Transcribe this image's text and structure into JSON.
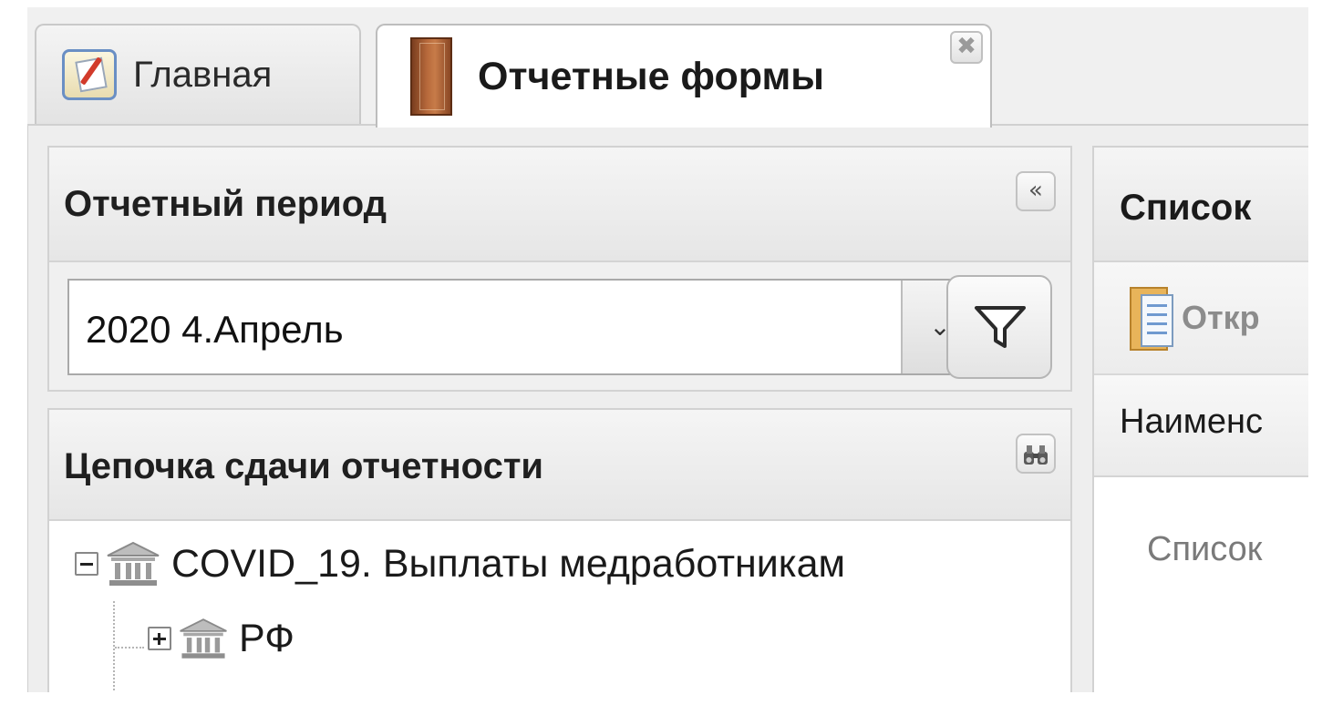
{
  "tabs": [
    {
      "label": "Главная",
      "icon": "home-edit-icon",
      "active": false
    },
    {
      "label": "Отчетные формы",
      "icon": "book-icon",
      "active": true,
      "closable": true
    }
  ],
  "tab_close_glyph": "✖",
  "period_panel": {
    "title": "Отчетный период",
    "collapse_glyph": "«",
    "selected_value": "2020 4.Апрель",
    "dropdown_glyph": "⌄"
  },
  "chain_panel": {
    "title": "Цепочка сдачи отчетности",
    "search_glyph": "🔍",
    "tree": [
      {
        "label": "COVID_19. Выплаты медработникам",
        "expanded": true,
        "level": 0
      },
      {
        "label": "РФ",
        "expanded": false,
        "level": 1
      }
    ]
  },
  "right_panel": {
    "title": "Список",
    "open_button": "Откр",
    "column_header": "Наименс",
    "empty_text": "Список"
  },
  "colors": {
    "header_bg": "#e6e6e6",
    "border": "#d2d2d2",
    "book": "#b86a3c",
    "home_icon_border": "#6a8fc4"
  }
}
